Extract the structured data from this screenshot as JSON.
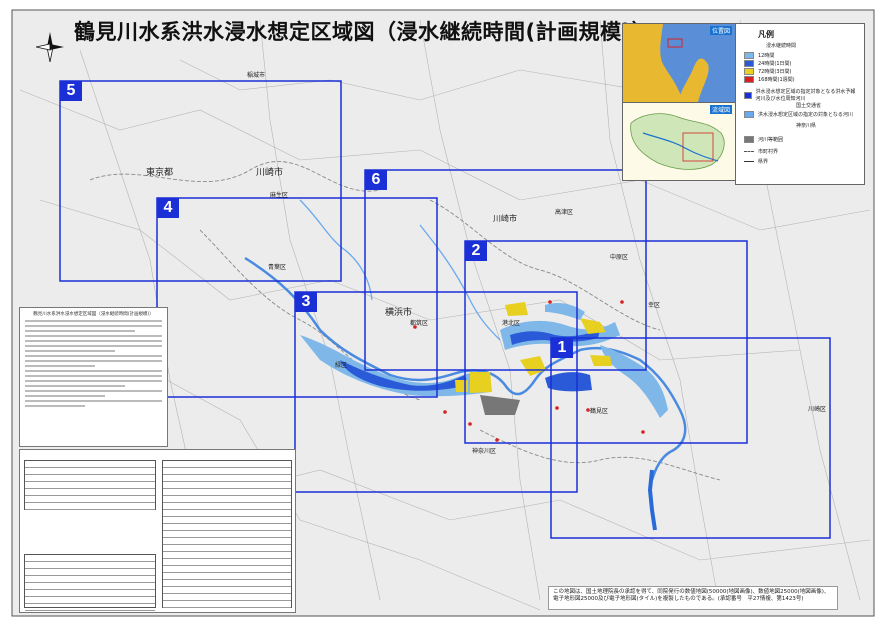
{
  "title": "鶴見川水系洪水浸水想定区域図（浸水継続時間(計画規模)）",
  "frames": [
    {
      "label": "1"
    },
    {
      "label": "2"
    },
    {
      "label": "3"
    },
    {
      "label": "4"
    },
    {
      "label": "5"
    },
    {
      "label": "6"
    }
  ],
  "places": {
    "inagi": "稲城市",
    "kawasaki_city": "川崎市",
    "tokyo": "東京都",
    "asao": "麻生区",
    "aoba": "青葉区",
    "yokohama": "横浜市",
    "kawasaki_nakahara": "中原区",
    "kohoku": "港北区",
    "tsuzuki": "都筑区",
    "midori": "緑区",
    "tsurumi": "鶴見区",
    "kanagawa": "神奈川区",
    "saiwai": "幸区",
    "kawasaki_ku": "川崎区",
    "takatsu": "高津区"
  },
  "legend": {
    "title": "凡例",
    "subtitle": "浸水継続時間",
    "items": [
      {
        "label": "12時間",
        "color": "#7fb8e8"
      },
      {
        "label": "24時間(1日間)",
        "color": "#2a5ad8"
      },
      {
        "label": "72時間(3日間)",
        "color": "#e8d020"
      },
      {
        "label": "168時間(1週間)",
        "color": "#d82020"
      }
    ],
    "items2": [
      {
        "label": "洪水浸水想定区域の指定対象となる洪水予報河川及び水位周知河川",
        "color": "#1b2fd6"
      },
      {
        "label": "国土交通省"
      },
      {
        "label": "洪水浸水想定区域の指定の対象となる河川",
        "color": "#6aa8f0"
      },
      {
        "label": "神奈川県"
      },
      {
        "label": "河川等範囲",
        "color": "#777"
      },
      {
        "label": "市町村界"
      },
      {
        "label": "県界"
      }
    ]
  },
  "inset_tags": {
    "top": "位置図",
    "bottom": "流域図"
  },
  "panel_title": "鶴見川水系洪水浸水想定区域図（浸水継続時間(計画規模)）",
  "footnote": "この地図は、国土地理院長の承認を得て、同院発行の数値地図(50000(地図画像)、数値地図25000(地図画像)、電子地形図25000及び電子地形図(タイル)を複製したものである。(承認番号　平27情複、第1423号)",
  "colors": {
    "frame": "#1b2fd6",
    "flood_light": "#7fb8e8",
    "flood_dark": "#2a5ad8",
    "flood_yellow": "#e8d020",
    "flood_red": "#d82020",
    "river": "#4a8ae0",
    "map_bg": "#e9e9e9"
  }
}
